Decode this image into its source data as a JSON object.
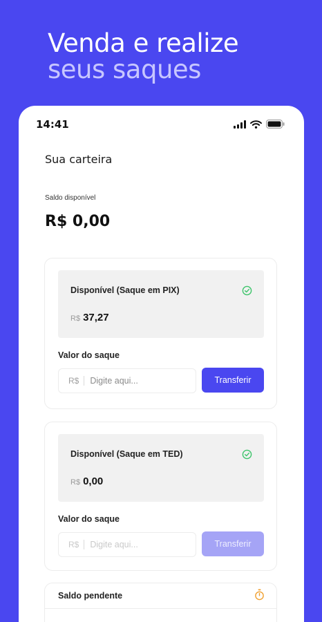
{
  "headline": {
    "line1": "Venda e realize",
    "line2": "seus saques"
  },
  "status_bar": {
    "time": "14:41",
    "icons": [
      "signal-icon",
      "wifi-icon",
      "battery-icon"
    ]
  },
  "wallet": {
    "title": "Sua carteira",
    "balance_label": "Saldo disponível",
    "balance_value": "R$ 0,00"
  },
  "cards": [
    {
      "title": "Disponível (Saque em PIX)",
      "currency": "R$",
      "amount": "37,27",
      "status_icon": "check-circle-icon",
      "withdraw_label": "Valor do saque",
      "input_currency": "R$",
      "input_placeholder": "Digite aqui...",
      "button_label": "Transferir",
      "enabled": true
    },
    {
      "title": "Disponível (Saque em TED)",
      "currency": "R$",
      "amount": "0,00",
      "status_icon": "check-circle-icon",
      "withdraw_label": "Valor do saque",
      "input_currency": "R$",
      "input_placeholder": "Digite aqui...",
      "button_label": "Transferir",
      "enabled": false
    }
  ],
  "pending": {
    "title": "Saldo pendente",
    "icon": "timer-icon"
  },
  "colors": {
    "brand": "#4a47f0",
    "brand_disabled": "#a5a4f6",
    "success": "#3cc46a",
    "warning": "#f0a030"
  }
}
